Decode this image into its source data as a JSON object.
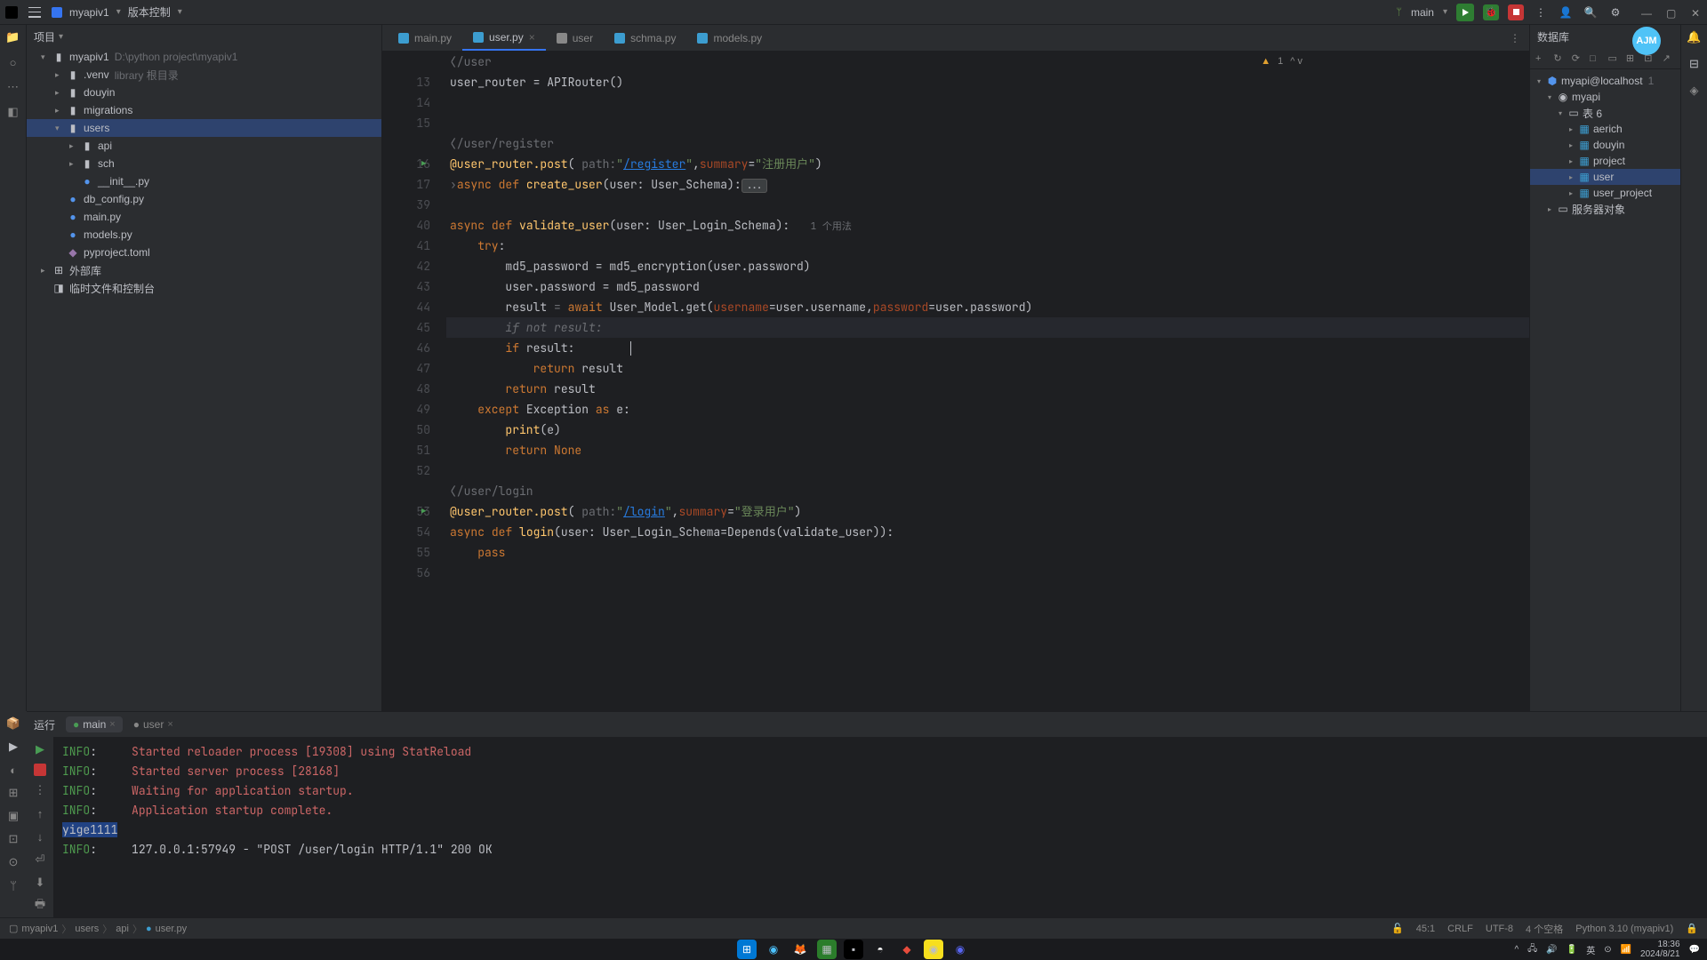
{
  "titlebar": {
    "project": "myapiv1",
    "vcs": "版本控制",
    "branch": "main"
  },
  "panels": {
    "project_header": "项目",
    "db_header": "数据库"
  },
  "project_tree": {
    "root": "myapiv1",
    "root_hint": "D:\\python project\\myapiv1",
    "venv": ".venv",
    "venv_hint": "library 根目录",
    "douyin": "douyin",
    "migrations": "migrations",
    "users": "users",
    "api": "api",
    "sch": "sch",
    "init_py": "__init__.py",
    "db_config": "db_config.py",
    "main_py": "main.py",
    "models_py": "models.py",
    "pyproject": "pyproject.toml",
    "external": "外部库",
    "scratches": "临时文件和控制台"
  },
  "tabs": [
    {
      "label": "main.py",
      "active": false
    },
    {
      "label": "user.py",
      "active": true
    },
    {
      "label": "user",
      "active": false
    },
    {
      "label": "schma.py",
      "active": false
    },
    {
      "label": "models.py",
      "active": false
    }
  ],
  "breadcrumb": "/user",
  "status_top": {
    "warnings": "1",
    "info": "^ v"
  },
  "code": {
    "l13": "user_router = APIRouter()",
    "l16_route": "/user/register",
    "l16": [
      "@user_router.post(",
      "path",
      "\"",
      "/register",
      "\",",
      "summary",
      "=",
      "\"注册用户\"",
      ")"
    ],
    "l17": [
      "async ",
      "def ",
      "create_user",
      "(user: User_Schema):",
      "..."
    ],
    "l40_usage": "1 个用法",
    "l40": [
      "async ",
      "def ",
      "validate_user",
      "(user: User_Login_Schema):"
    ],
    "l41": [
      "try",
      ":"
    ],
    "l42": "md5_password = md5_encryption(user.password)",
    "l43": "user.password = md5_password",
    "l44": [
      "result ",
      "= ",
      "await ",
      "User_Model.get(",
      "username",
      "=user.username,",
      "password",
      "=user.password)"
    ],
    "l45": "if not result:",
    "l46": [
      "if ",
      "result:"
    ],
    "l47": [
      "return ",
      "result"
    ],
    "l48": [
      "return ",
      "result"
    ],
    "l49": [
      "except ",
      "Exception ",
      "as ",
      "e:"
    ],
    "l50": [
      "print",
      "(e)"
    ],
    "l51": [
      "return ",
      "None"
    ],
    "l53_route": "/user/login",
    "l53": [
      "@user_router.post(",
      "path",
      "\"",
      "/login",
      "\",",
      "summary",
      "=",
      "\"登录用户\"",
      ")"
    ],
    "l54": [
      "async ",
      "def ",
      "login",
      "(user: User_Login_Schema=Depends(validate_user)):"
    ],
    "l55": [
      "pass"
    ]
  },
  "db_toolbar_icons": [
    "+",
    "↻",
    "⟳",
    "□",
    "▭",
    "⊞",
    "⊡",
    "↗"
  ],
  "db_tree": {
    "conn": "myapi@localhost",
    "conn_hint": "1",
    "db": "myapi",
    "schemas": "表 6",
    "tables": [
      "aerich",
      "douyin",
      "project",
      "user",
      "user_project"
    ],
    "server": "服务器对象"
  },
  "run": {
    "label": "运行",
    "tabs": [
      {
        "label": "main",
        "active": true
      },
      {
        "label": "user",
        "active": false
      }
    ]
  },
  "console_lines": [
    {
      "type": "info",
      "text": "Started reloader process [19308] using StatReload",
      "color": "red"
    },
    {
      "type": "info",
      "text": "Started server process [28168]",
      "color": "red"
    },
    {
      "type": "info",
      "text": "Waiting for application startup.",
      "color": "red"
    },
    {
      "type": "info",
      "text": "Application startup complete.",
      "color": "red"
    },
    {
      "type": "plain",
      "text": "yige1111",
      "hl": true
    },
    {
      "type": "info",
      "text": "127.0.0.1:57949 - \"POST /user/login HTTP/1.1\" 200 OK",
      "color": "dim"
    }
  ],
  "statusbar": {
    "crumbs": [
      "myapiv1",
      "users",
      "api",
      "user.py"
    ],
    "pos": "45:1",
    "eol": "CRLF",
    "enc": "UTF-8",
    "indent": "4 个空格",
    "interpreter": "Python 3.10 (myapiv1)"
  },
  "taskbar": {
    "time": "18:36",
    "date": "2024/8/21"
  }
}
